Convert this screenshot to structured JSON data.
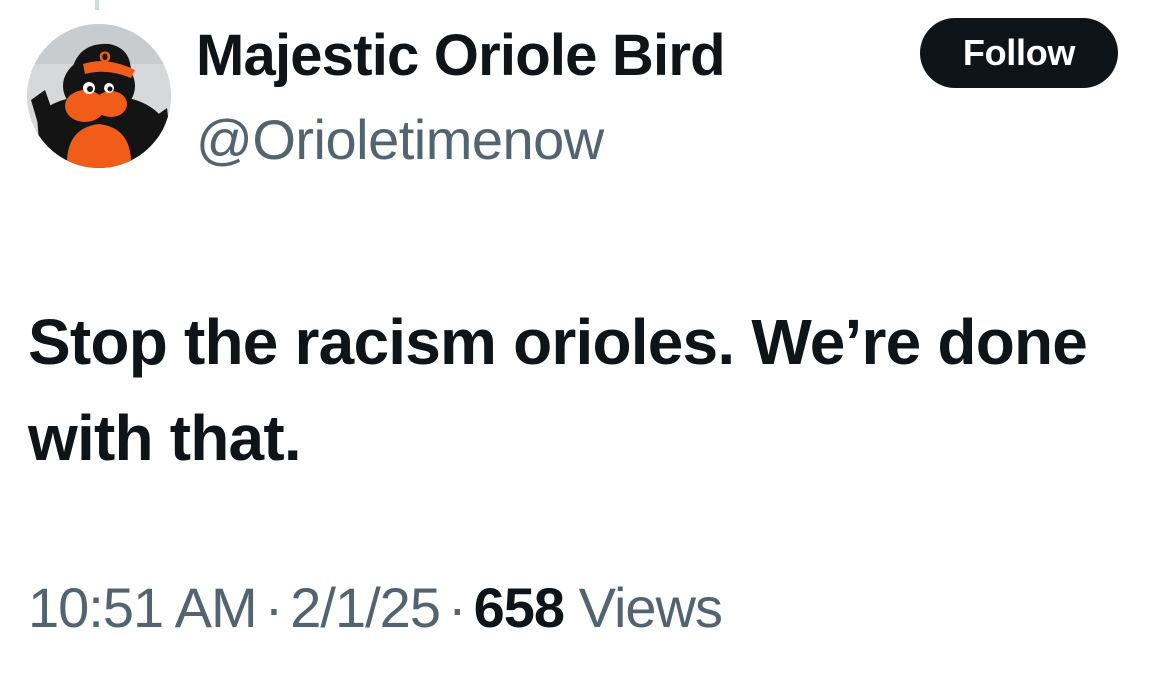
{
  "author": {
    "display_name": "Majestic Oriole Bird",
    "handle": "@Orioletimenow",
    "avatar_icon": "oriole-bird-mascot-avatar"
  },
  "follow_button": {
    "label": "Follow"
  },
  "tweet": {
    "text": "Stop the racism orioles. We’re done with that."
  },
  "meta": {
    "time": "10:51 AM",
    "separator": "·",
    "date": "2/1/25",
    "views_count": "658",
    "views_label": "Views"
  },
  "colors": {
    "text_primary": "#0f1419",
    "text_secondary": "#536471",
    "button_bg": "#0f1419",
    "button_text": "#ffffff",
    "mascot_orange": "#f25c1b"
  }
}
